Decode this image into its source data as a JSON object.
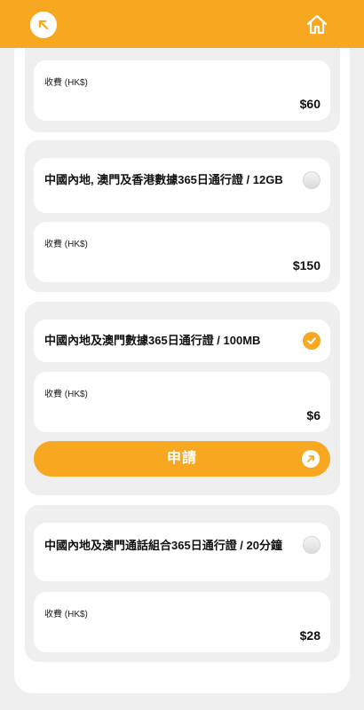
{
  "header": {
    "back_icon": "arrow-up-left-icon",
    "home_icon": "home-icon"
  },
  "plans": [
    {
      "name": "",
      "fee_label": "收費 (HK$)",
      "fee": "$60",
      "selected": false
    },
    {
      "name": "中國內地, 澳門及香港數據365日通行證 / 12GB",
      "fee_label": "收費 (HK$)",
      "fee": "$150",
      "selected": false
    },
    {
      "name": "中國內地及澳門數據365日通行證 / 100MB",
      "fee_label": "收費 (HK$)",
      "fee": "$6",
      "selected": true,
      "apply_label": "申請"
    },
    {
      "name": "中國內地及澳門通話組合365日通行證 / 20分鐘",
      "fee_label": "收費 (HK$)",
      "fee": "$28",
      "selected": false
    }
  ],
  "colors": {
    "accent": "#f7a820",
    "background": "#efefef",
    "card": "#ffffff"
  }
}
